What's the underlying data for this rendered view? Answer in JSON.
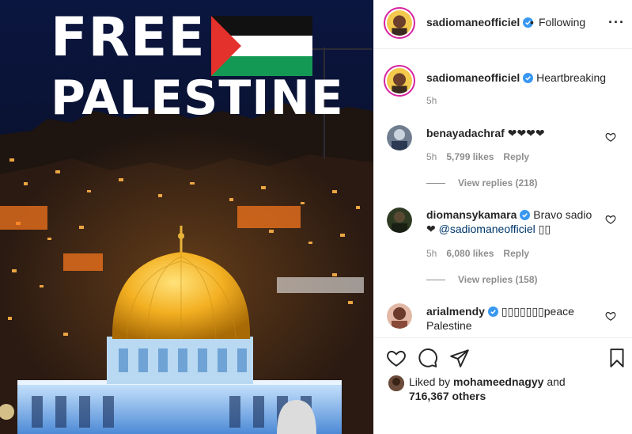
{
  "photo": {
    "headline_line1": "FREE",
    "headline_line2": "PALESTINE",
    "flag_colors": {
      "black": "#111111",
      "white": "#ffffff",
      "green": "#149954",
      "red": "#e4312b"
    }
  },
  "post_header": {
    "username": "sadiomaneofficiel",
    "separator": "•",
    "follow_status": "Following",
    "more_icon": "more-horizontal-icon"
  },
  "caption": {
    "username": "sadiomaneofficiel",
    "text": "Heartbreaking",
    "time": "5h"
  },
  "comments": [
    {
      "username": "benayadachraf",
      "text": "❤❤❤❤",
      "time": "5h",
      "likes": "5,799 likes",
      "reply_label": "Reply",
      "view_replies": "View replies (218)"
    },
    {
      "username": "diomansykamara",
      "text": "Bravo sadio",
      "text_line2_prefix": "❤",
      "mention": "@sadiomaneofficiel",
      "text_suffix": "▯▯",
      "time": "5h",
      "likes": "6,080 likes",
      "reply_label": "Reply",
      "view_replies": "View replies (158)"
    },
    {
      "username": "arialmendy",
      "text": "▯▯▯▯▯▯▯peace",
      "text_line2": "Palestine"
    }
  ],
  "actions": {
    "like_icon": "heart-icon",
    "comment_icon": "comment-icon",
    "share_icon": "send-icon",
    "save_icon": "bookmark-icon",
    "liked_by_prefix": "Liked by",
    "liked_by_user": "mohameednagyy",
    "liked_by_and": "and",
    "others_count": "716,367 others"
  },
  "colors": {
    "verified_blue": "#3897f0",
    "text": "#262626",
    "muted": "#8e8e8e",
    "mention": "#00376b",
    "story_ring": "#d6249f"
  }
}
